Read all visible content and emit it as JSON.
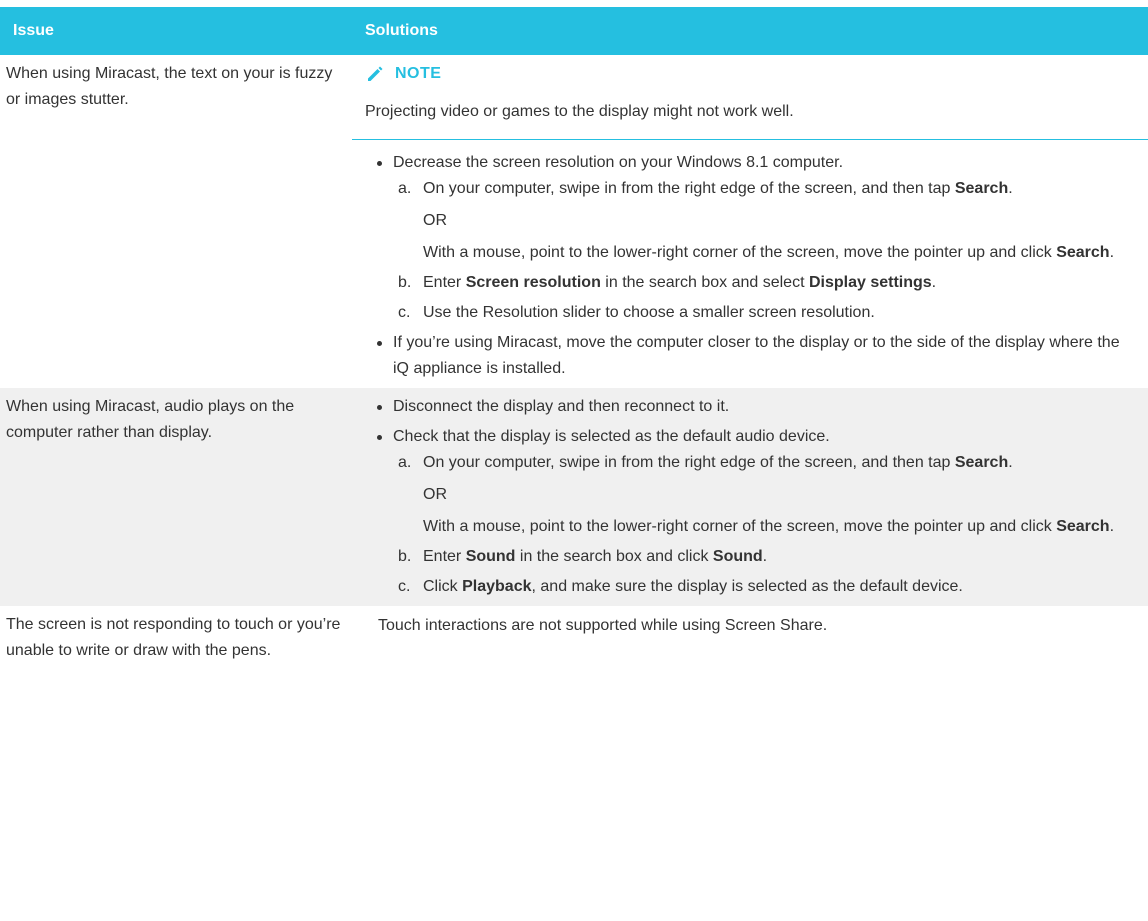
{
  "table": {
    "headers": {
      "issue": "Issue",
      "solutions": "Solutions"
    },
    "row1": {
      "issue": "When using Miracast, the text on your is fuzzy or images stutter.",
      "note_label": "NOTE",
      "note_text": "Projecting video or games to the display might not work well.",
      "bullet1": "Decrease the screen resolution on your Windows 8.1 computer.",
      "step_a": {
        "letter": "a.",
        "text1": "On your computer, swipe in from the right edge of the screen, and then tap ",
        "bold1": "Search",
        "end1": ".",
        "or": "OR",
        "text2": "With a mouse, point to the lower-right corner of the screen, move the pointer up and click ",
        "bold2": "Search",
        "end2": "."
      },
      "step_b": {
        "letter": "b.",
        "t1": "Enter ",
        "b1": "Screen resolution",
        "t2": " in the search box and select ",
        "b2": "Display settings",
        "t3": "."
      },
      "step_c": {
        "letter": "c.",
        "text": "Use the Resolution slider to choose a smaller screen resolution."
      },
      "bullet2": "If you’re using Miracast, move the computer closer to the display or to the side of the display where the iQ appliance is installed."
    },
    "row2": {
      "issue": "When using Miracast, audio plays on the computer rather than display.",
      "bullet1": "Disconnect the display and then reconnect to it.",
      "bullet2": "Check that the display is selected as the default audio device.",
      "step_a": {
        "letter": "a.",
        "text1": "On your computer, swipe in from the right edge of the screen, and then tap ",
        "bold1": "Search",
        "end1": ".",
        "or": "OR",
        "text2": "With a mouse, point to the lower-right corner of the screen, move the pointer up and click ",
        "bold2": "Search",
        "end2": "."
      },
      "step_b": {
        "letter": "b.",
        "t1": "Enter ",
        "b1": "Sound",
        "t2": " in the search box and click ",
        "b2": "Sound",
        "t3": "."
      },
      "step_c": {
        "letter": "c.",
        "t1": "Click ",
        "b1": "Playback",
        "t2": ", and make sure the display is selected as the default device."
      }
    },
    "row3": {
      "issue": "The screen is not responding to touch or you’re unable to write or draw with the pens.",
      "solution": "Touch interactions are not supported while using Screen Share."
    }
  },
  "colors": {
    "header_bg": "#25bfe0",
    "alt_row_bg": "#f0f0f0",
    "text": "#333333"
  },
  "icons": {
    "note": "pencil-icon"
  }
}
